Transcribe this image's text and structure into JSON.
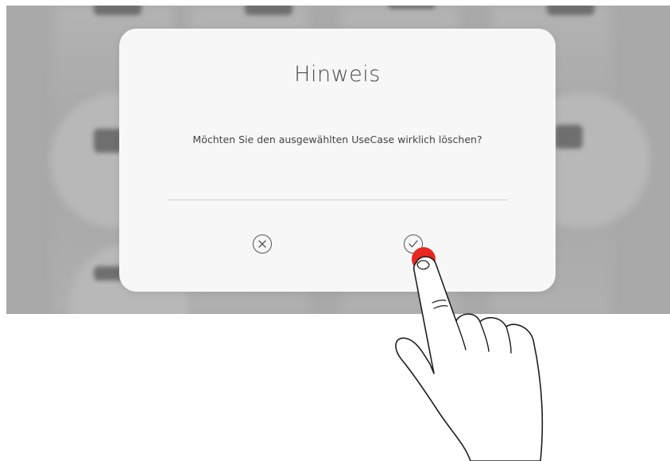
{
  "dialog": {
    "title": "Hinweis",
    "message": "Möchten Sie den ausgewählten UseCase wirklich löschen?",
    "cancel_icon": "close-circle-icon",
    "confirm_icon": "check-circle-icon"
  },
  "colors": {
    "dialog_bg": "#f7f7f7",
    "backdrop": "#a9a9a9",
    "touch_indicator": "#e8281e"
  }
}
